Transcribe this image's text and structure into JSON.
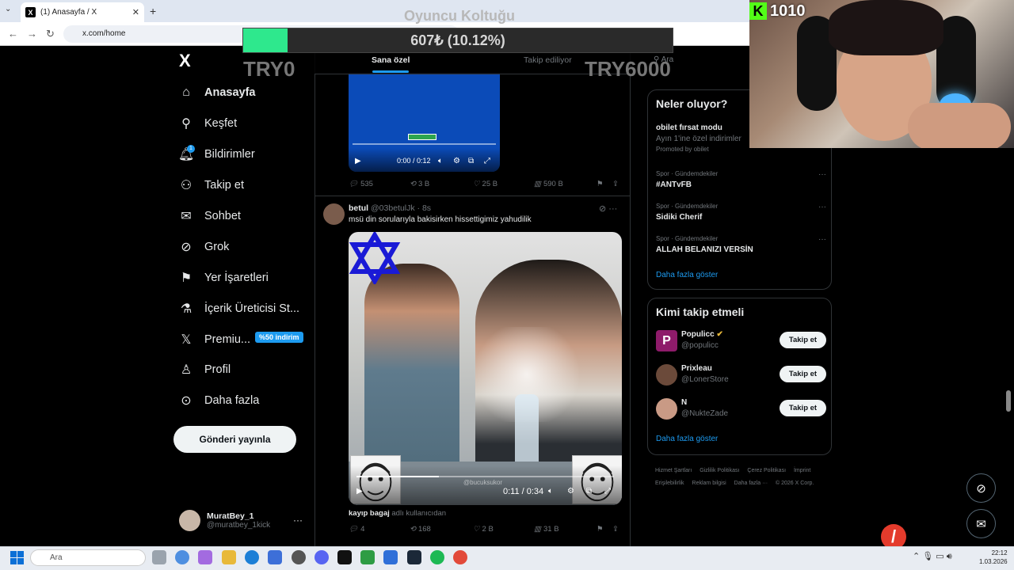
{
  "browser": {
    "tab_title": "(1) Anasayfa / X",
    "tab_icon": "x-icon",
    "tab_close": "✕",
    "new_tab": "+",
    "tab_list": "⌄",
    "url": "x.com/home",
    "nav": {
      "back": "←",
      "forward": "→",
      "reload": "↻"
    }
  },
  "stream": {
    "overlay_title": "Oyuncu Koltuğu",
    "progress_text": "607₺ (10.12%)",
    "progress_fraction": 0.1012,
    "progress_color": "#2ee88d",
    "goal_min": "TRY0",
    "goal_max": "TRY6000",
    "kick_icon": "K",
    "kick_viewers": "1010"
  },
  "sidebar": {
    "logo": "X",
    "items": [
      {
        "label": "Anasayfa",
        "icon": "home-icon",
        "glyph": "⌂"
      },
      {
        "label": "Keşfet",
        "icon": "search-icon",
        "glyph": "⚲"
      },
      {
        "label": "Bildirimler",
        "icon": "bell-icon",
        "glyph": "🔔︎",
        "badge": "1"
      },
      {
        "label": "Takip et",
        "icon": "person-add-icon",
        "glyph": "⚇"
      },
      {
        "label": "Sohbet",
        "icon": "mail-icon",
        "glyph": "✉"
      },
      {
        "label": "Grok",
        "icon": "grok-icon",
        "glyph": "⊘"
      },
      {
        "label": "Yer İşaretleri",
        "icon": "bookmark-icon",
        "glyph": "⚑"
      },
      {
        "label": "İçerik Üreticisi St...",
        "icon": "flask-icon",
        "glyph": "⚗"
      },
      {
        "label": "Premiu...",
        "icon": "x-premium-icon",
        "glyph": "𝕏",
        "promo": "%50 indirim"
      },
      {
        "label": "Profil",
        "icon": "profile-icon",
        "glyph": "♙"
      },
      {
        "label": "Daha fazla",
        "icon": "more-circle-icon",
        "glyph": "⊙"
      }
    ],
    "post_button": "Gönderi yayınla",
    "account": {
      "name": "MuratBey_1",
      "handle": "@muratbey_1kick",
      "more": "···"
    }
  },
  "feed": {
    "tabs": [
      "Sana özel",
      "Takip ediliyor"
    ],
    "post1": {
      "video_time": "0:00 / 0:12",
      "replies": "535",
      "reposts": "3 B",
      "likes": "25 B",
      "views": "590 B"
    },
    "post2": {
      "author": "betul",
      "handle": "@03betulJk · 8s",
      "text": "msü din sorularıyla bakisirken hissettigimiz yahudilik",
      "video_time": "0:11 / 0:34",
      "video_progress": 0.32,
      "watermark": "@bucuksukor",
      "caption_name": "kayıp bagaj",
      "caption_suffix": "adlı kullanıcıdan",
      "replies": "4",
      "reposts": "168",
      "likes": "2 B",
      "views": "31 B"
    }
  },
  "right": {
    "search_placeholder": "Ara",
    "trends_title": "Neler oluyor?",
    "promo": {
      "title": "obilet fırsat modu",
      "desc": "Ayın 1'ine özel indirimler",
      "by": "Promoted by obilet"
    },
    "trends": [
      {
        "category": "Spor · Gündemdekiler",
        "title": "#ANTvFB"
      },
      {
        "category": "Spor · Gündemdekiler",
        "title": "Sidiki Cherif"
      },
      {
        "category": "Spor · Gündemdekiler",
        "title": "ALLAH BELANIZI VERSİN"
      }
    ],
    "show_more": "Daha fazla göster",
    "who_title": "Kimi takip etmeli",
    "who": [
      {
        "name": "Populicc",
        "handle": "@populicc",
        "verified": true,
        "color": "#8e1b6a"
      },
      {
        "name": "Prixleau",
        "handle": "@LonerStore",
        "verified": false,
        "color": "#6b4a3a"
      },
      {
        "name": "N",
        "handle": "@NukteZade",
        "verified": false,
        "color": "#c99a85"
      }
    ],
    "follow_label": "Takip et",
    "footer": [
      "Hizmet Şartları",
      "Gizlilik Politikası",
      "Çerez Politikası",
      "İmprint",
      "Erişilebilirlik",
      "Reklam bilgisi",
      "Daha fazla ···",
      "© 2026 X Corp."
    ]
  },
  "taskbar": {
    "search_placeholder": "Ara",
    "time": "22:12",
    "date": "1.03.2026",
    "tray": "⌃  🎙︎ ▭ 🔊︎"
  }
}
